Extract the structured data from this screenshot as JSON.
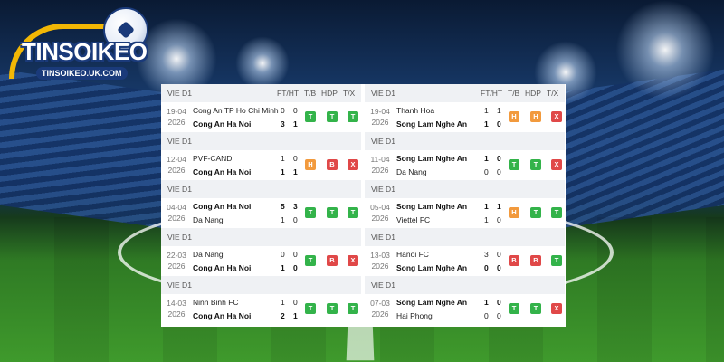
{
  "site": {
    "logo_text": "TINSOIKEO",
    "logo_url": "TINSOIKEO.UK.COM"
  },
  "badge_colors": {
    "T": "#33b34a",
    "H": "#f29a3d",
    "B": "#e04848",
    "X": "#e04848"
  },
  "headers": {
    "ftht": "FT/HT",
    "tb": "T/B",
    "hdp": "HDP",
    "tx": "T/X"
  },
  "left": {
    "league": "VIE D1",
    "matches": [
      {
        "date": "19-04",
        "year": "2026",
        "team1": "Cong An TP Ho Chi Minh",
        "team2": "Cong An Ha Noi",
        "bold": 2,
        "ft1": "0",
        "ht1": "0",
        "ft2": "3",
        "ht2": "1",
        "tb": "T",
        "hdp": "T",
        "tx": "T"
      },
      {
        "date": "12-04",
        "year": "2026",
        "team1": "PVF-CAND",
        "team2": "Cong An Ha Noi",
        "bold": 2,
        "ft1": "1",
        "ht1": "0",
        "ft2": "1",
        "ht2": "1",
        "tb": "H",
        "hdp": "B",
        "tx": "X"
      },
      {
        "date": "04-04",
        "year": "2026",
        "team1": "Cong An Ha Noi",
        "team2": "Da Nang",
        "bold": 1,
        "ft1": "5",
        "ht1": "3",
        "ft2": "1",
        "ht2": "0",
        "tb": "T",
        "hdp": "T",
        "tx": "T"
      },
      {
        "date": "22-03",
        "year": "2026",
        "team1": "Da Nang",
        "team2": "Cong An Ha Noi",
        "bold": 2,
        "ft1": "0",
        "ht1": "0",
        "ft2": "1",
        "ht2": "0",
        "tb": "T",
        "hdp": "B",
        "tx": "X"
      },
      {
        "date": "14-03",
        "year": "2026",
        "team1": "Ninh Binh FC",
        "team2": "Cong An Ha Noi",
        "bold": 2,
        "ft1": "1",
        "ht1": "0",
        "ft2": "2",
        "ht2": "1",
        "tb": "T",
        "hdp": "T",
        "tx": "T"
      }
    ]
  },
  "right": {
    "league": "VIE D1",
    "matches": [
      {
        "date": "19-04",
        "year": "2026",
        "team1": "Thanh Hoa",
        "team2": "Song Lam Nghe An",
        "bold": 2,
        "ft1": "1",
        "ht1": "1",
        "ft2": "1",
        "ht2": "0",
        "tb": "H",
        "hdp": "H",
        "tx": "X"
      },
      {
        "date": "11-04",
        "year": "2026",
        "team1": "Song Lam Nghe An",
        "team2": "Da Nang",
        "bold": 1,
        "ft1": "1",
        "ht1": "0",
        "ft2": "0",
        "ht2": "0",
        "tb": "T",
        "hdp": "T",
        "tx": "X"
      },
      {
        "date": "05-04",
        "year": "2026",
        "team1": "Song Lam Nghe An",
        "team2": "Viettel FC",
        "bold": 1,
        "ft1": "1",
        "ht1": "1",
        "ft2": "1",
        "ht2": "0",
        "tb": "H",
        "hdp": "T",
        "tx": "T"
      },
      {
        "date": "13-03",
        "year": "2026",
        "team1": "Hanoi FC",
        "team2": "Song Lam Nghe An",
        "bold": 2,
        "ft1": "3",
        "ht1": "0",
        "ft2": "0",
        "ht2": "0",
        "tb": "B",
        "hdp": "B",
        "tx": "T"
      },
      {
        "date": "07-03",
        "year": "2026",
        "team1": "Song Lam Nghe An",
        "team2": "Hai Phong",
        "bold": 1,
        "ft1": "1",
        "ht1": "0",
        "ft2": "0",
        "ht2": "0",
        "tb": "T",
        "hdp": "T",
        "tx": "X"
      }
    ]
  }
}
